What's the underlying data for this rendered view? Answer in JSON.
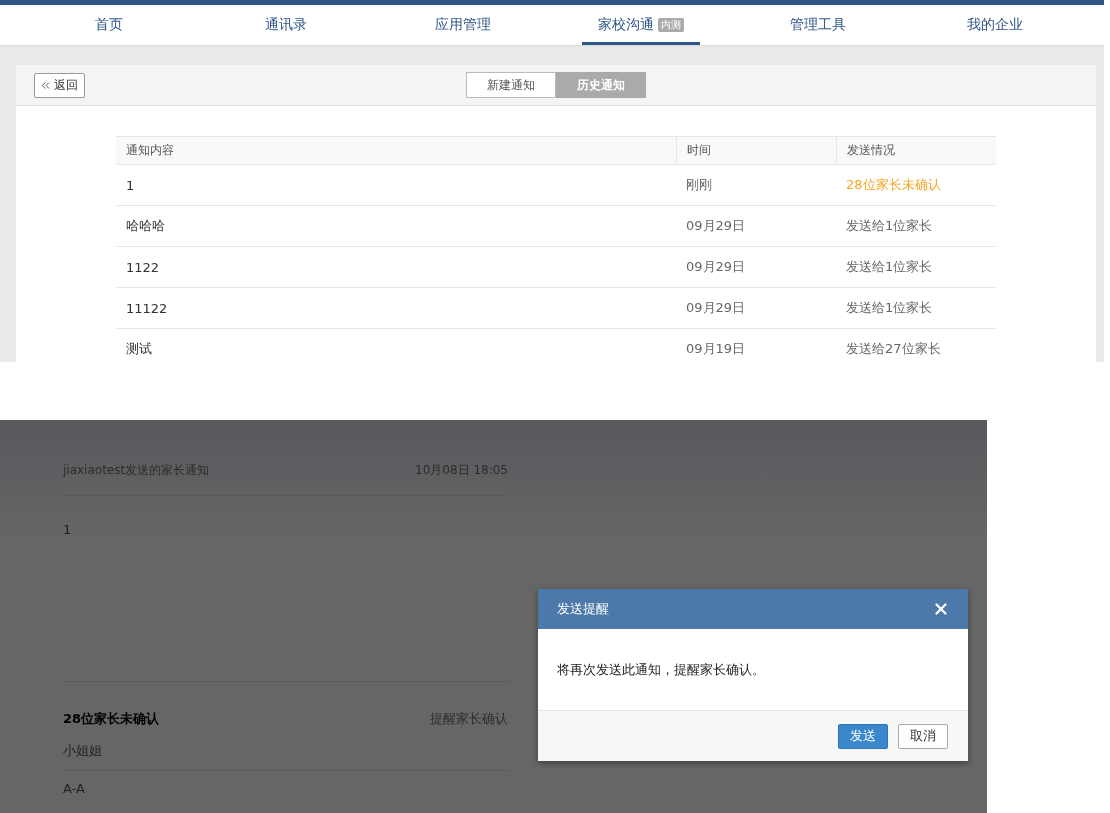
{
  "nav": {
    "items": [
      {
        "label": "首页",
        "selected": false
      },
      {
        "label": "通讯录",
        "selected": false
      },
      {
        "label": "应用管理",
        "selected": false
      },
      {
        "label": "家校沟通",
        "selected": true,
        "badge": "内测"
      },
      {
        "label": "管理工具",
        "selected": false
      },
      {
        "label": "我的企业",
        "selected": false
      }
    ]
  },
  "toolbar": {
    "back": "返回",
    "segments": [
      {
        "label": "新建通知",
        "selected": false
      },
      {
        "label": "历史通知",
        "selected": true
      }
    ]
  },
  "table": {
    "columns": [
      "通知内容",
      "时间",
      "发送情况"
    ],
    "rows": [
      {
        "content": "1",
        "time": "刚刚",
        "status": "28位家长未确认",
        "highlight": true
      },
      {
        "content": "哈哈哈",
        "time": "09月29日",
        "status": "发送给1位家长",
        "highlight": false
      },
      {
        "content": "1122",
        "time": "09月29日",
        "status": "发送给1位家长",
        "highlight": false
      },
      {
        "content": "11122",
        "time": "09月29日",
        "status": "发送给1位家长",
        "highlight": false
      },
      {
        "content": "测试",
        "time": "09月19日",
        "status": "发送给27位家长",
        "highlight": false
      }
    ]
  },
  "detail": {
    "sender": "jiaxiaotest发送的家长通知",
    "time": "10月08日 18:05",
    "body": "1",
    "unconfirmed": "28位家长未确认",
    "remind": "提醒家长确认",
    "parents": [
      "小姐姐",
      "A-A"
    ]
  },
  "dialog": {
    "title": "发送提醒",
    "message": "将再次发送此通知，提醒家长确认。",
    "buttons": [
      {
        "label": "发送",
        "kind": "primary"
      },
      {
        "label": "取消",
        "kind": "default"
      }
    ]
  }
}
